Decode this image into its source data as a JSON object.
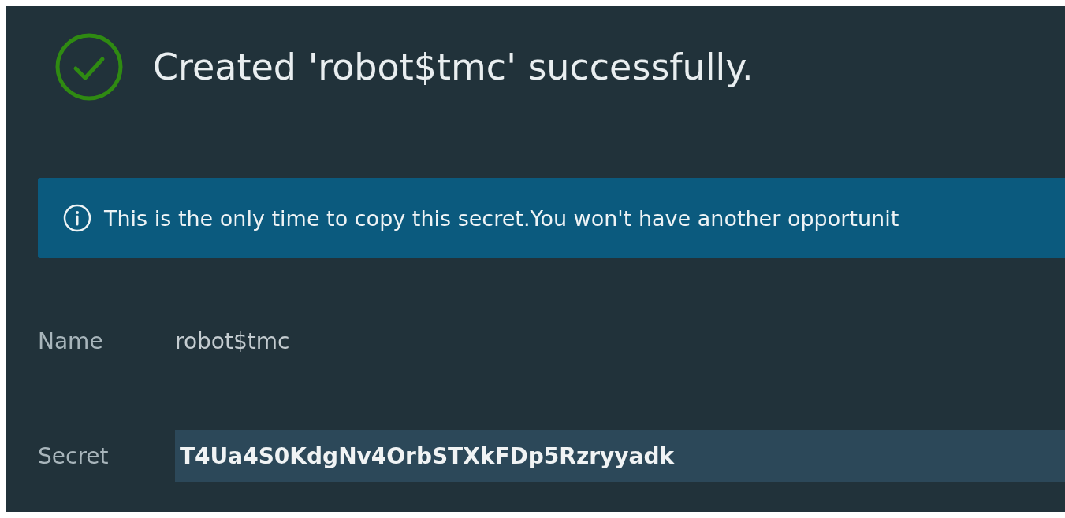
{
  "header": {
    "title": "Created 'robot$tmc' successfully."
  },
  "alert": {
    "text": "This is the only time to copy this secret.You won't have another opportunit"
  },
  "fields": [
    {
      "kind": "text",
      "label": "Name",
      "value": "robot$tmc"
    },
    {
      "kind": "secret",
      "label": "Secret",
      "value": "T4Ua4S0KdgNv4OrbSTXkFDp5Rzryyadk"
    }
  ]
}
